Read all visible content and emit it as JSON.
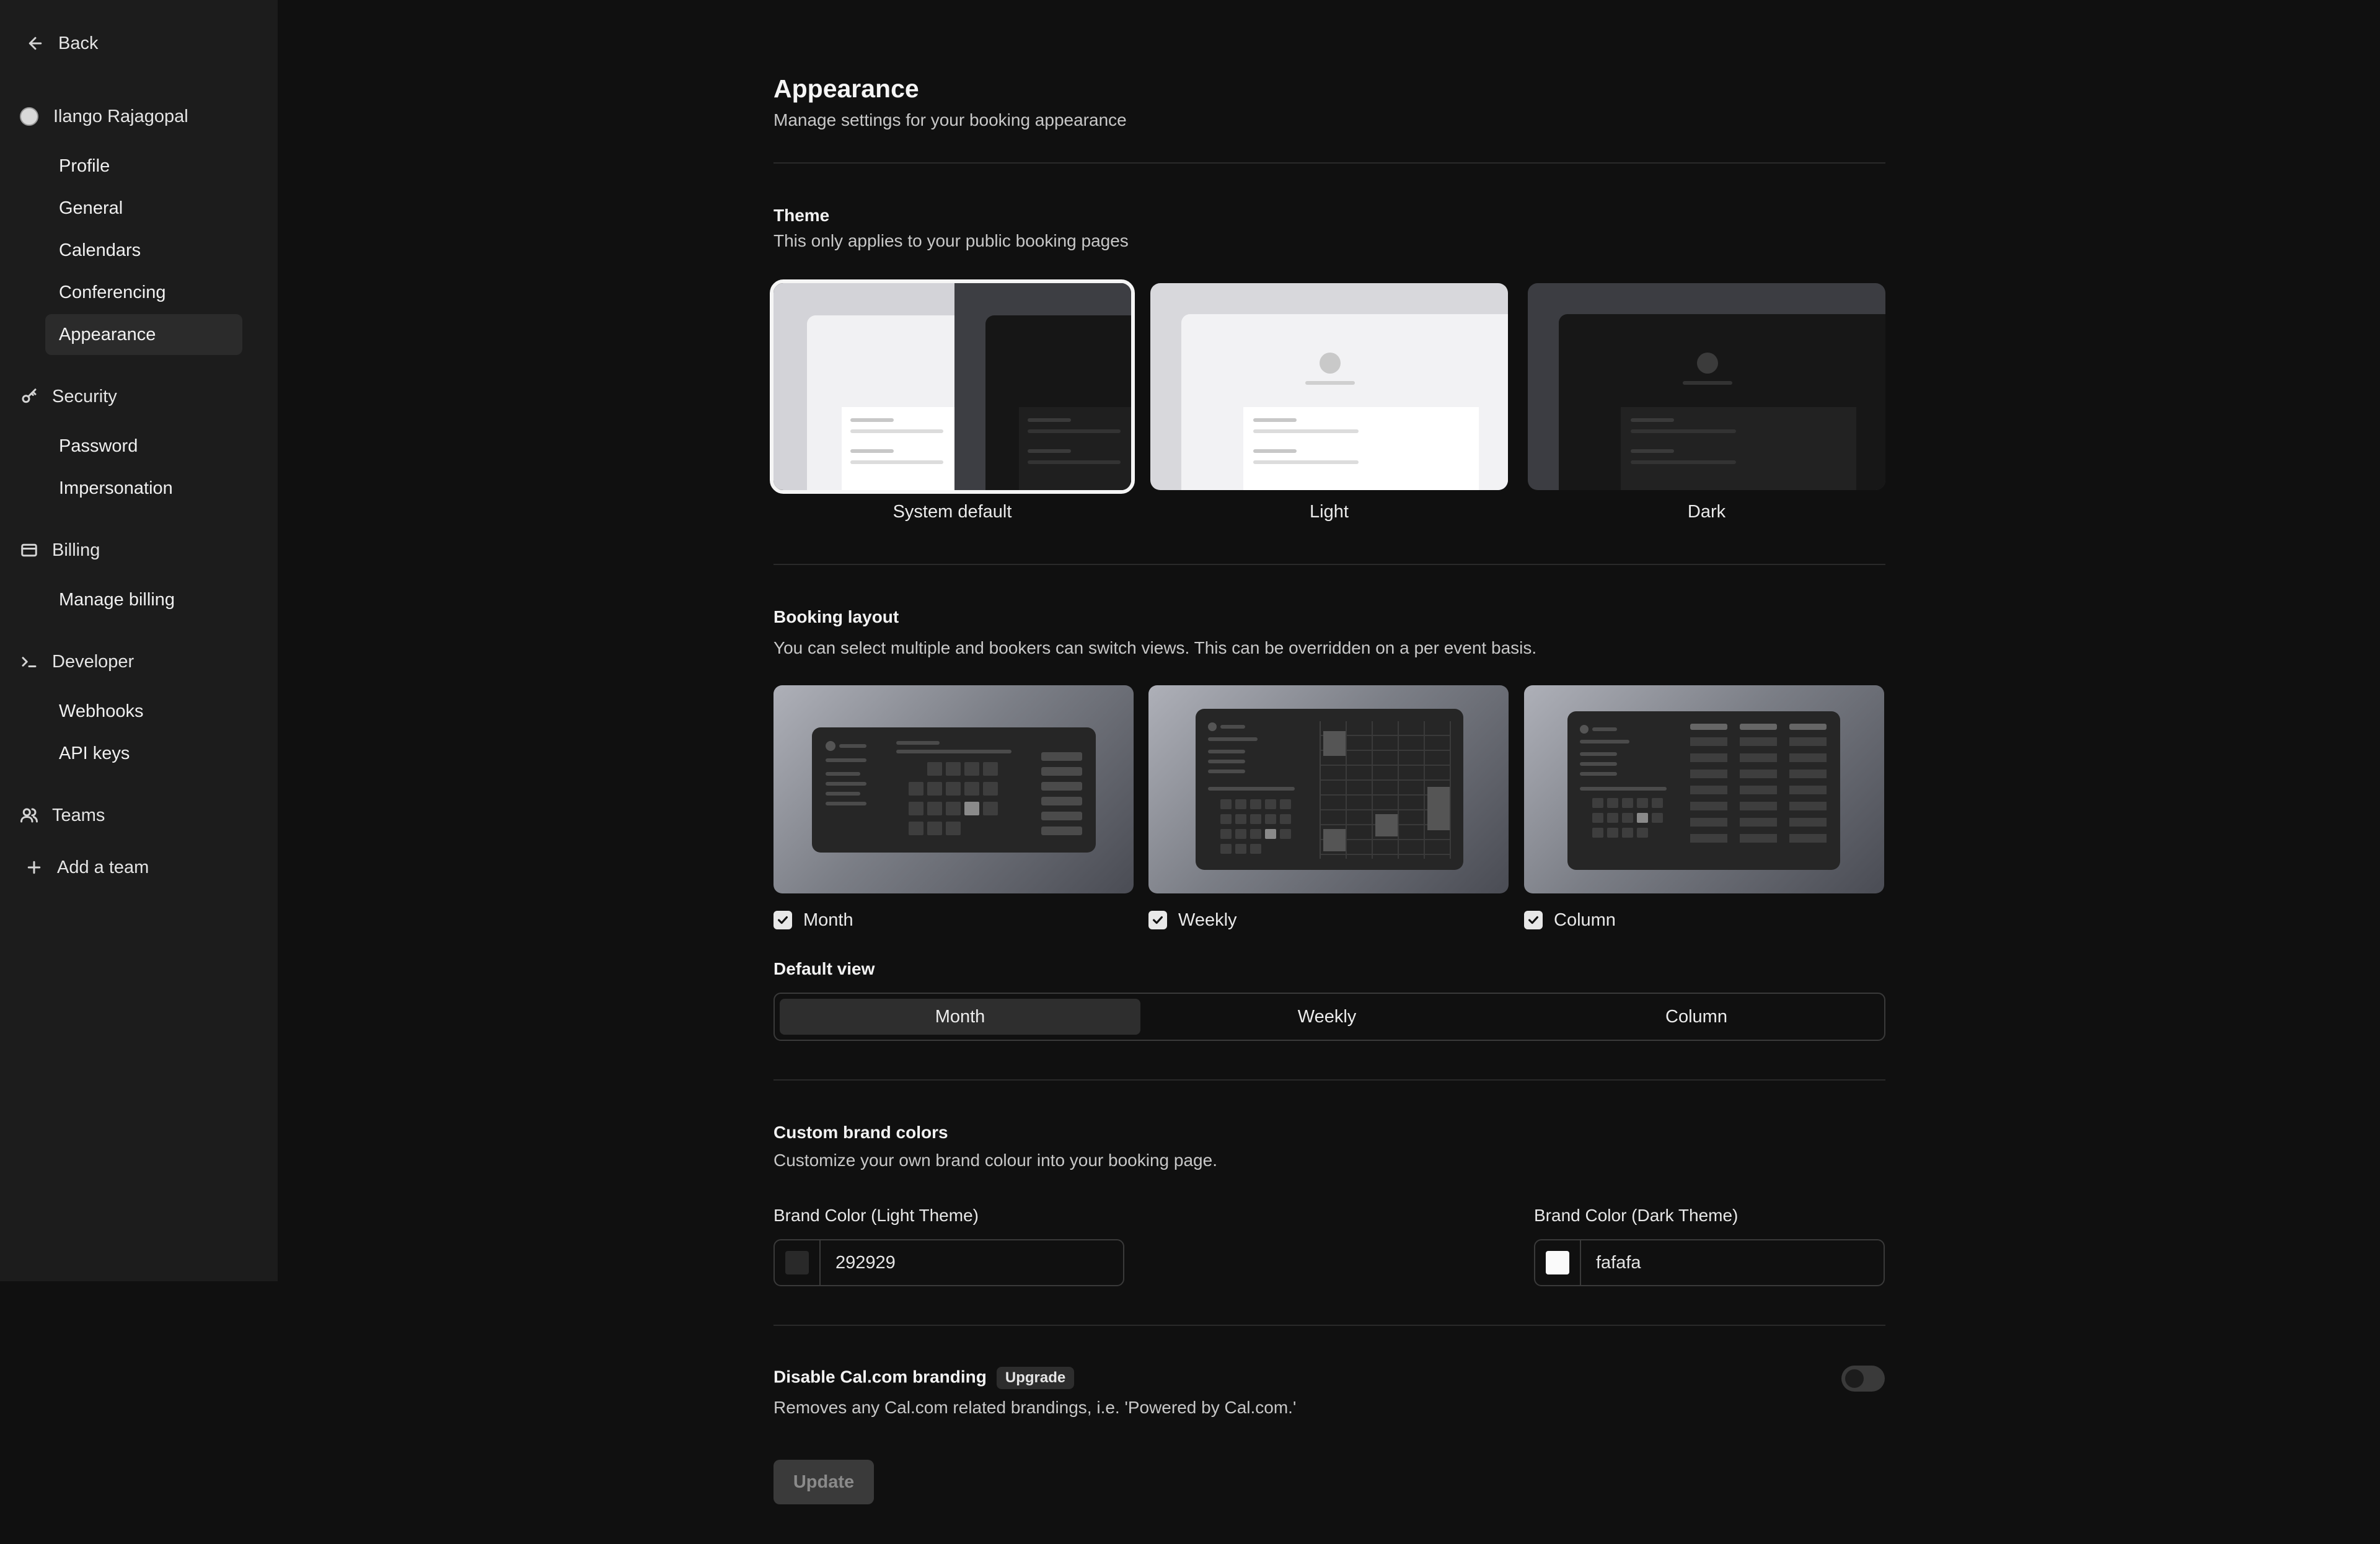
{
  "sidebar": {
    "back_label": "Back",
    "user_name": "Ilango Rajagopal",
    "profile_items": [
      {
        "label": "Profile"
      },
      {
        "label": "General"
      },
      {
        "label": "Calendars"
      },
      {
        "label": "Conferencing"
      },
      {
        "label": "Appearance"
      }
    ],
    "security": {
      "label": "Security",
      "items": [
        {
          "label": "Password"
        },
        {
          "label": "Impersonation"
        }
      ]
    },
    "billing": {
      "label": "Billing",
      "items": [
        {
          "label": "Manage billing"
        }
      ]
    },
    "developer": {
      "label": "Developer",
      "items": [
        {
          "label": "Webhooks"
        },
        {
          "label": "API keys"
        }
      ]
    },
    "teams_label": "Teams",
    "add_team_label": "Add a team"
  },
  "header": {
    "title": "Appearance",
    "subtitle": "Manage settings for your booking appearance"
  },
  "theme": {
    "title": "Theme",
    "description": "This only applies to your public booking pages",
    "options": [
      {
        "label": "System default",
        "selected": true
      },
      {
        "label": "Light",
        "selected": false
      },
      {
        "label": "Dark",
        "selected": false
      }
    ]
  },
  "booking_layout": {
    "title": "Booking layout",
    "description": "You can select multiple and bookers can switch views. This can be overridden on a per event basis.",
    "options": [
      {
        "label": "Month",
        "checked": true
      },
      {
        "label": "Weekly",
        "checked": true
      },
      {
        "label": "Column",
        "checked": true
      }
    ],
    "default_view_label": "Default view",
    "default_view_options": [
      "Month",
      "Weekly",
      "Column"
    ],
    "default_view_selected": "Month"
  },
  "brand_colors": {
    "title": "Custom brand colors",
    "description": "Customize your own brand colour into your booking page.",
    "light_label": "Brand Color (Light Theme)",
    "light_value": "292929",
    "light_swatch": "#292929",
    "dark_label": "Brand Color (Dark Theme)",
    "dark_value": "fafafa",
    "dark_swatch": "#fafafa"
  },
  "branding": {
    "title": "Disable Cal.com branding",
    "badge": "Upgrade",
    "description": "Removes any Cal.com related brandings, i.e. 'Powered by Cal.com.'",
    "toggle_on": false
  },
  "update_label": "Update"
}
